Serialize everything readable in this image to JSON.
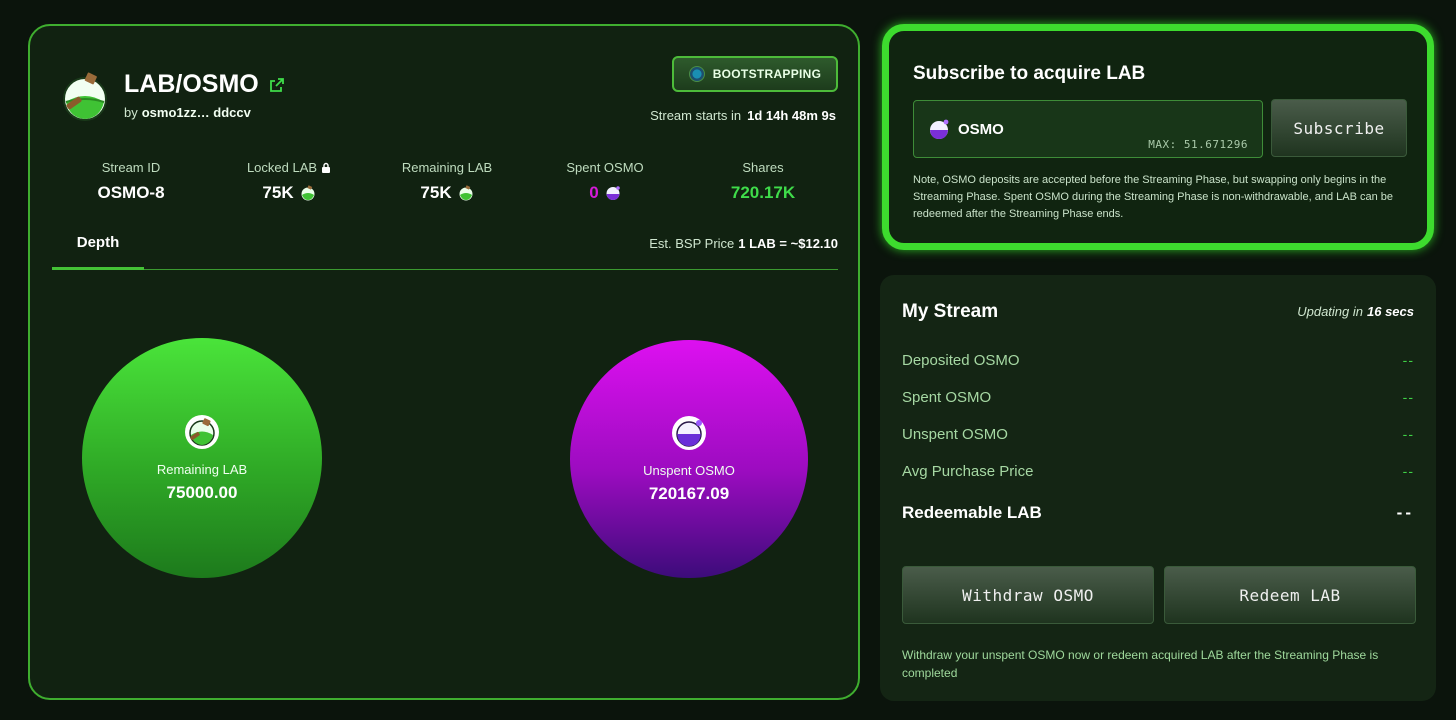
{
  "pair": {
    "title": "LAB/OSMO",
    "by_label": "by",
    "creator": "osmo1zz… ddccv",
    "status": "BOOTSTRAPPING",
    "stream_starts_label": "Stream starts in",
    "stream_starts_value": "1d 14h 48m 9s"
  },
  "stats": {
    "stream_id_label": "Stream ID",
    "stream_id_value": "OSMO-8",
    "locked_label": "Locked LAB",
    "locked_value": "75K",
    "remaining_label": "Remaining LAB",
    "remaining_value": "75K",
    "spent_label": "Spent OSMO",
    "spent_value": "0",
    "shares_label": "Shares",
    "shares_value": "720.17K"
  },
  "tabs": {
    "depth": "Depth",
    "bsp_label": "Est. BSP Price",
    "bsp_value": "1 LAB = ~$12.10"
  },
  "depth": {
    "remaining_label": "Remaining LAB",
    "remaining_value": "75000.00",
    "unspent_label": "Unspent OSMO",
    "unspent_value": "720167.09"
  },
  "subscribe": {
    "title": "Subscribe to acquire LAB",
    "token": "OSMO",
    "max": "MAX: 51.671296",
    "button": "Subscribe",
    "note": "Note, OSMO deposits are accepted before the Streaming Phase, but swapping only begins in the Streaming Phase. Spent OSMO during the Streaming Phase is non-withdrawable, and LAB can be redeemed after the Streaming Phase ends."
  },
  "my_stream": {
    "title": "My Stream",
    "updating_label": "Updating in",
    "updating_value": "16 secs",
    "rows": [
      {
        "label": "Deposited OSMO",
        "value": "--"
      },
      {
        "label": "Spent OSMO",
        "value": "--"
      },
      {
        "label": "Unspent OSMO",
        "value": "--"
      },
      {
        "label": "Avg Purchase Price",
        "value": "--"
      },
      {
        "label": "Redeemable LAB",
        "value": "--"
      }
    ],
    "withdraw_button": "Withdraw OSMO",
    "redeem_button": "Redeem LAB",
    "note": "Withdraw your unspent OSMO now or redeem acquired LAB after the Streaming Phase is completed"
  },
  "colors": {
    "accent_green": "#3ddb2e",
    "spent_purple": "#d41ad8",
    "shares_green": "#3fdc4a",
    "background": "#0b140c"
  },
  "icons": [
    "lab-token-icon",
    "osmo-token-icon",
    "external-link-icon",
    "lock-icon",
    "status-dot-icon"
  ]
}
